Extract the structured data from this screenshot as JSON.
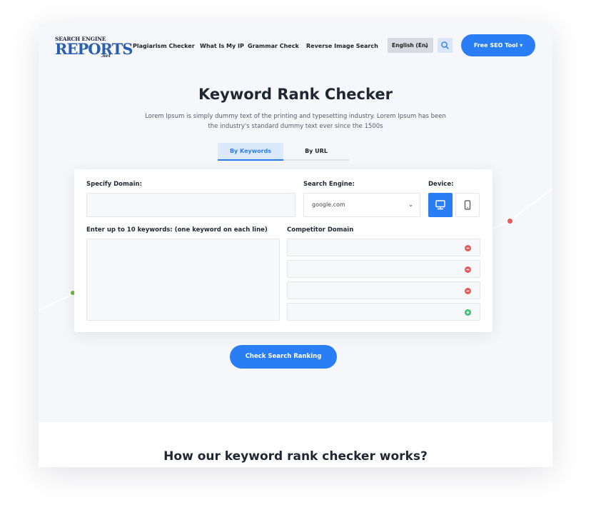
{
  "header": {
    "logo": {
      "top_line": "SEARCH ENGINE",
      "main": "REPORTS",
      "suffix": ".net"
    },
    "nav": [
      "Plagiarism Checker",
      "What Is My IP",
      "Grammar Check",
      "Reverse Image Search"
    ],
    "language": "English (En)",
    "seo_button": "Free SEO Tool"
  },
  "hero": {
    "title": "Keyword Rank Checker",
    "description_line1": "Lorem Ipsum is simply dummy text of the printing and typesetting industry. Lorem Ipsum has been",
    "description_line2": "the industry's standard dummy text ever since the 1500s"
  },
  "tabs": [
    {
      "label": "By Keywords",
      "active": true
    },
    {
      "label": "By URL",
      "active": false
    }
  ],
  "form": {
    "domain_label": "Specify Domain:",
    "domain_value": "",
    "engine_label": "Search Engine:",
    "engine_value": "google.com",
    "device_label": "Device:",
    "selected_device": "desktop",
    "keywords_label": "Enter up to 10 keywords: (one keyword on each line)",
    "keywords_value": "",
    "competitor_label": "Competitor Domain",
    "competitor_fields": [
      {
        "value": "",
        "action": "remove"
      },
      {
        "value": "",
        "action": "remove"
      },
      {
        "value": "",
        "action": "remove"
      },
      {
        "value": "",
        "action": "add"
      }
    ],
    "submit_label": "Check Search Ranking"
  },
  "section": {
    "heading": "How our keyword rank checker works?"
  },
  "icons": {
    "search": "search-icon",
    "desktop": "desktop-icon",
    "mobile": "mobile-icon",
    "remove": "minus-circle-icon",
    "add": "plus-circle-icon",
    "chevron": "chevron-down-icon"
  },
  "colors": {
    "primary": "#2a7ef5",
    "remove": "#e85a5a",
    "add": "#3cbf6a",
    "tab_active_bg": "#dce9fb"
  }
}
